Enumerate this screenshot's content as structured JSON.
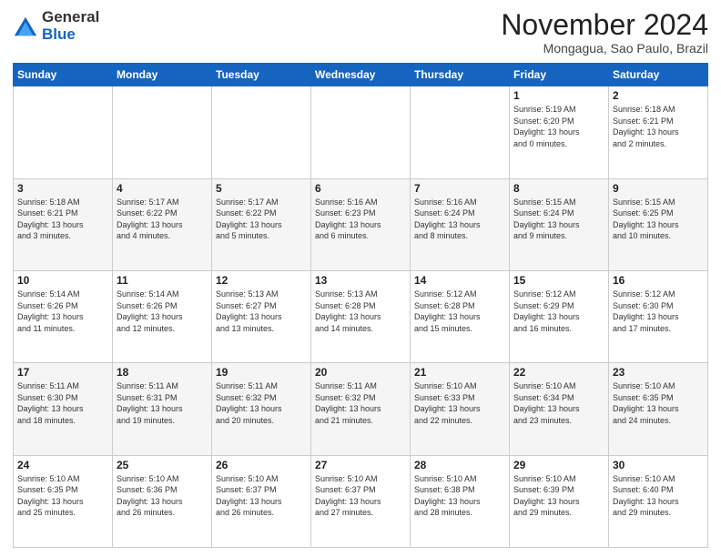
{
  "logo": {
    "general": "General",
    "blue": "Blue"
  },
  "header": {
    "month": "November 2024",
    "location": "Mongagua, Sao Paulo, Brazil"
  },
  "days_of_week": [
    "Sunday",
    "Monday",
    "Tuesday",
    "Wednesday",
    "Thursday",
    "Friday",
    "Saturday"
  ],
  "weeks": [
    [
      {
        "day": "",
        "info": ""
      },
      {
        "day": "",
        "info": ""
      },
      {
        "day": "",
        "info": ""
      },
      {
        "day": "",
        "info": ""
      },
      {
        "day": "",
        "info": ""
      },
      {
        "day": "1",
        "info": "Sunrise: 5:19 AM\nSunset: 6:20 PM\nDaylight: 13 hours\nand 0 minutes."
      },
      {
        "day": "2",
        "info": "Sunrise: 5:18 AM\nSunset: 6:21 PM\nDaylight: 13 hours\nand 2 minutes."
      }
    ],
    [
      {
        "day": "3",
        "info": "Sunrise: 5:18 AM\nSunset: 6:21 PM\nDaylight: 13 hours\nand 3 minutes."
      },
      {
        "day": "4",
        "info": "Sunrise: 5:17 AM\nSunset: 6:22 PM\nDaylight: 13 hours\nand 4 minutes."
      },
      {
        "day": "5",
        "info": "Sunrise: 5:17 AM\nSunset: 6:22 PM\nDaylight: 13 hours\nand 5 minutes."
      },
      {
        "day": "6",
        "info": "Sunrise: 5:16 AM\nSunset: 6:23 PM\nDaylight: 13 hours\nand 6 minutes."
      },
      {
        "day": "7",
        "info": "Sunrise: 5:16 AM\nSunset: 6:24 PM\nDaylight: 13 hours\nand 8 minutes."
      },
      {
        "day": "8",
        "info": "Sunrise: 5:15 AM\nSunset: 6:24 PM\nDaylight: 13 hours\nand 9 minutes."
      },
      {
        "day": "9",
        "info": "Sunrise: 5:15 AM\nSunset: 6:25 PM\nDaylight: 13 hours\nand 10 minutes."
      }
    ],
    [
      {
        "day": "10",
        "info": "Sunrise: 5:14 AM\nSunset: 6:26 PM\nDaylight: 13 hours\nand 11 minutes."
      },
      {
        "day": "11",
        "info": "Sunrise: 5:14 AM\nSunset: 6:26 PM\nDaylight: 13 hours\nand 12 minutes."
      },
      {
        "day": "12",
        "info": "Sunrise: 5:13 AM\nSunset: 6:27 PM\nDaylight: 13 hours\nand 13 minutes."
      },
      {
        "day": "13",
        "info": "Sunrise: 5:13 AM\nSunset: 6:28 PM\nDaylight: 13 hours\nand 14 minutes."
      },
      {
        "day": "14",
        "info": "Sunrise: 5:12 AM\nSunset: 6:28 PM\nDaylight: 13 hours\nand 15 minutes."
      },
      {
        "day": "15",
        "info": "Sunrise: 5:12 AM\nSunset: 6:29 PM\nDaylight: 13 hours\nand 16 minutes."
      },
      {
        "day": "16",
        "info": "Sunrise: 5:12 AM\nSunset: 6:30 PM\nDaylight: 13 hours\nand 17 minutes."
      }
    ],
    [
      {
        "day": "17",
        "info": "Sunrise: 5:11 AM\nSunset: 6:30 PM\nDaylight: 13 hours\nand 18 minutes."
      },
      {
        "day": "18",
        "info": "Sunrise: 5:11 AM\nSunset: 6:31 PM\nDaylight: 13 hours\nand 19 minutes."
      },
      {
        "day": "19",
        "info": "Sunrise: 5:11 AM\nSunset: 6:32 PM\nDaylight: 13 hours\nand 20 minutes."
      },
      {
        "day": "20",
        "info": "Sunrise: 5:11 AM\nSunset: 6:32 PM\nDaylight: 13 hours\nand 21 minutes."
      },
      {
        "day": "21",
        "info": "Sunrise: 5:10 AM\nSunset: 6:33 PM\nDaylight: 13 hours\nand 22 minutes."
      },
      {
        "day": "22",
        "info": "Sunrise: 5:10 AM\nSunset: 6:34 PM\nDaylight: 13 hours\nand 23 minutes."
      },
      {
        "day": "23",
        "info": "Sunrise: 5:10 AM\nSunset: 6:35 PM\nDaylight: 13 hours\nand 24 minutes."
      }
    ],
    [
      {
        "day": "24",
        "info": "Sunrise: 5:10 AM\nSunset: 6:35 PM\nDaylight: 13 hours\nand 25 minutes."
      },
      {
        "day": "25",
        "info": "Sunrise: 5:10 AM\nSunset: 6:36 PM\nDaylight: 13 hours\nand 26 minutes."
      },
      {
        "day": "26",
        "info": "Sunrise: 5:10 AM\nSunset: 6:37 PM\nDaylight: 13 hours\nand 26 minutes."
      },
      {
        "day": "27",
        "info": "Sunrise: 5:10 AM\nSunset: 6:37 PM\nDaylight: 13 hours\nand 27 minutes."
      },
      {
        "day": "28",
        "info": "Sunrise: 5:10 AM\nSunset: 6:38 PM\nDaylight: 13 hours\nand 28 minutes."
      },
      {
        "day": "29",
        "info": "Sunrise: 5:10 AM\nSunset: 6:39 PM\nDaylight: 13 hours\nand 29 minutes."
      },
      {
        "day": "30",
        "info": "Sunrise: 5:10 AM\nSunset: 6:40 PM\nDaylight: 13 hours\nand 29 minutes."
      }
    ]
  ]
}
